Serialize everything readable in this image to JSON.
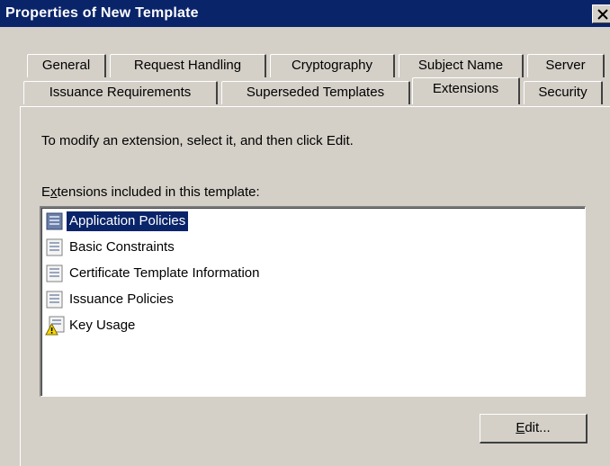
{
  "window": {
    "title": "Properties of New Template",
    "close_glyph": "×"
  },
  "tabs": {
    "row_back": [
      {
        "label": "General"
      },
      {
        "label": "Request Handling"
      },
      {
        "label": "Cryptography"
      },
      {
        "label": "Subject Name"
      },
      {
        "label": "Server"
      }
    ],
    "row_front": [
      {
        "label": "Issuance Requirements"
      },
      {
        "label": "Superseded Templates"
      },
      {
        "label": "Extensions",
        "active": true
      },
      {
        "label": "Security"
      }
    ]
  },
  "extensions_tab": {
    "instruction": "To modify an extension, select it, and then click Edit.",
    "list_label_accel": "x",
    "list_label_pre": "E",
    "list_label_post": "tensions included in this template:",
    "items": [
      {
        "label": "Application Policies",
        "selected": true,
        "icon": "extension-icon"
      },
      {
        "label": "Basic Constraints",
        "icon": "extension-icon"
      },
      {
        "label": "Certificate Template Information",
        "icon": "extension-icon"
      },
      {
        "label": "Issuance Policies",
        "icon": "extension-icon"
      },
      {
        "label": "Key Usage",
        "icon": "extension-warning-icon"
      }
    ],
    "edit_button_accel": "E",
    "edit_button_post": "dit..."
  }
}
